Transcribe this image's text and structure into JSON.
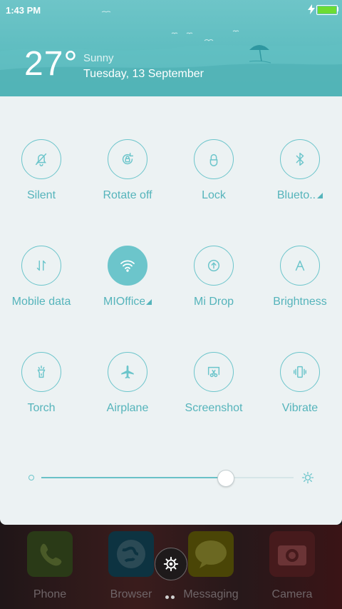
{
  "status_bar": {
    "time": "1:43 PM",
    "battery_level": 1.0
  },
  "weather": {
    "temperature": "27°",
    "condition": "Sunny",
    "date": "Tuesday, 13 September"
  },
  "toggles": [
    {
      "label": "Silent",
      "icon": "bell-off-icon",
      "active": false
    },
    {
      "label": "Rotate off",
      "icon": "rotate-lock-icon",
      "active": false
    },
    {
      "label": "Lock",
      "icon": "lock-icon",
      "active": false
    },
    {
      "label": "Blueto..",
      "icon": "bluetooth-icon",
      "active": false,
      "expandable": true
    },
    {
      "label": "Mobile data",
      "icon": "mobile-data-icon",
      "active": false
    },
    {
      "label": "MIOffice",
      "icon": "wifi-icon",
      "active": true,
      "expandable": true
    },
    {
      "label": "Mi Drop",
      "icon": "mi-drop-icon",
      "active": false
    },
    {
      "label": "Brightness",
      "icon": "brightness-auto-icon",
      "active": false
    },
    {
      "label": "Torch",
      "icon": "torch-icon",
      "active": false
    },
    {
      "label": "Airplane",
      "icon": "airplane-icon",
      "active": false
    },
    {
      "label": "Screenshot",
      "icon": "screenshot-icon",
      "active": false
    },
    {
      "label": "Vibrate",
      "icon": "vibrate-icon",
      "active": false
    }
  ],
  "brightness_slider": {
    "value": 0.73
  },
  "dock": [
    {
      "label": "Phone",
      "icon": "phone-icon",
      "color": "#3b4a1f"
    },
    {
      "label": "Browser",
      "icon": "globe-icon",
      "color": "#0f3a4a"
    },
    {
      "label": "Messaging",
      "icon": "message-icon",
      "color": "#4a4a0f"
    },
    {
      "label": "Camera",
      "icon": "camera-icon",
      "color": "#4a1a1c"
    }
  ],
  "colors": {
    "accent": "#6cc5cb",
    "panel": "#ecf2f3",
    "header": "#5ebdc0",
    "battery": "#6ddc33"
  }
}
